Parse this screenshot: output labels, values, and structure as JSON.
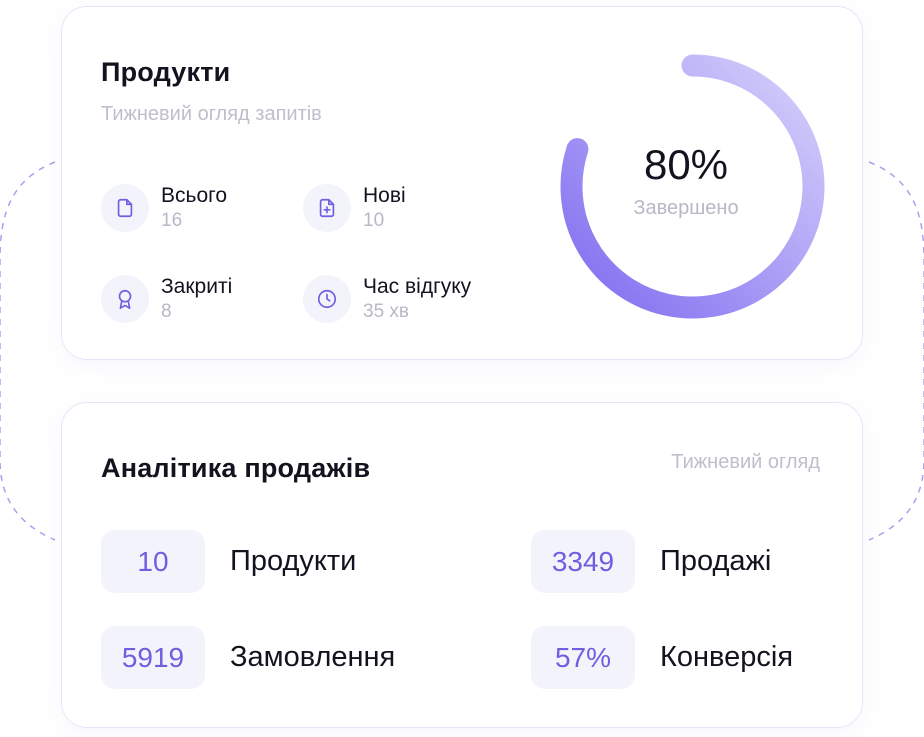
{
  "colors": {
    "accent": "#6f5fe0",
    "ring_start": "#7e6cf0",
    "ring_end": "#d7d2fb",
    "muted": "#b8b8c6"
  },
  "products": {
    "title": "Продукти",
    "subtitle": "Тижневий огляд запитів",
    "stats": [
      {
        "icon": "document-icon",
        "label": "Всього",
        "value": "16"
      },
      {
        "icon": "add-document-icon",
        "label": "Нові",
        "value": "10"
      },
      {
        "icon": "award-icon",
        "label": "Закриті",
        "value": "8"
      },
      {
        "icon": "clock-icon",
        "label": "Час відгуку",
        "value": "35 хв"
      }
    ],
    "progress": {
      "percent_text": "80%",
      "label": "Завершено",
      "fraction": 0.8
    }
  },
  "sales": {
    "title": "Аналітика продажів",
    "subtitle": "Тижневий огляд",
    "metrics": [
      {
        "value": "10",
        "label": "Продукти"
      },
      {
        "value": "3349",
        "label": "Продажі"
      },
      {
        "value": "5919",
        "label": "Замовлення"
      },
      {
        "value": "57%",
        "label": "Конверсія"
      }
    ]
  }
}
